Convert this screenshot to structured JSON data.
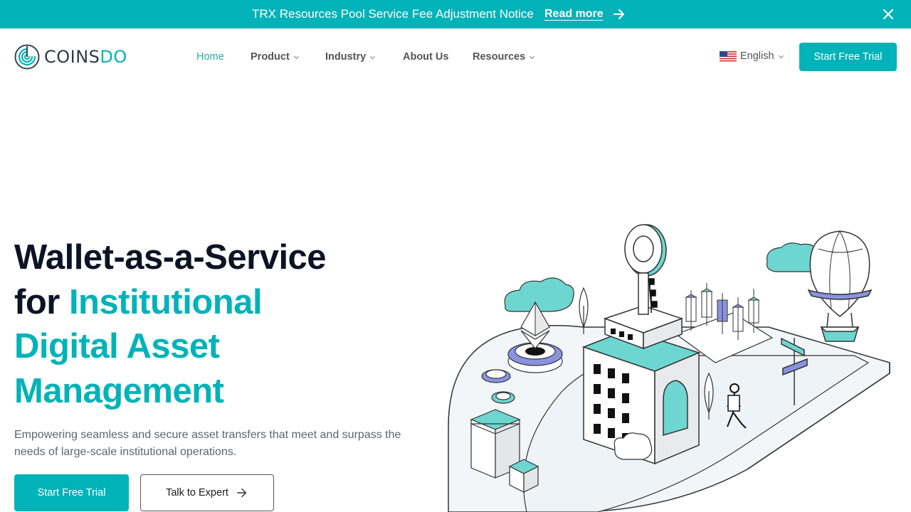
{
  "announcement": {
    "text": "TRX Resources Pool Service Fee Adjustment Notice",
    "link": "Read more"
  },
  "header": {
    "logo_text_main": "COINS",
    "logo_text_accent": "DO",
    "nav": [
      {
        "label": "Home",
        "active": true,
        "dropdown": false
      },
      {
        "label": "Product",
        "active": false,
        "dropdown": true
      },
      {
        "label": "Industry",
        "active": false,
        "dropdown": true
      },
      {
        "label": "About Us",
        "active": false,
        "dropdown": false
      },
      {
        "label": "Resources",
        "active": false,
        "dropdown": true
      }
    ],
    "language": "English",
    "cta": "Start Free Trial"
  },
  "hero": {
    "title_line1": "Wallet-as-a-Service",
    "title_for": "for ",
    "title_accent1": "Institutional",
    "title_accent2": "Digital Asset",
    "title_accent3": "Management",
    "subtitle": "Empowering seamless and secure asset transfers that meet and surpass the needs of large-scale institutional operations.",
    "primary_button": "Start Free Trial",
    "secondary_button": "Talk to Expert"
  },
  "colors": {
    "brand": "#00b3b8",
    "heading": "#0c1424",
    "body": "#5c6570"
  },
  "icons": {
    "announcement_arrow": "arrow-right-icon",
    "announcement_close": "close-icon",
    "dropdown": "chevron-down-icon",
    "language_flag": "us-flag-icon",
    "expert_arrow": "arrow-right-icon"
  }
}
